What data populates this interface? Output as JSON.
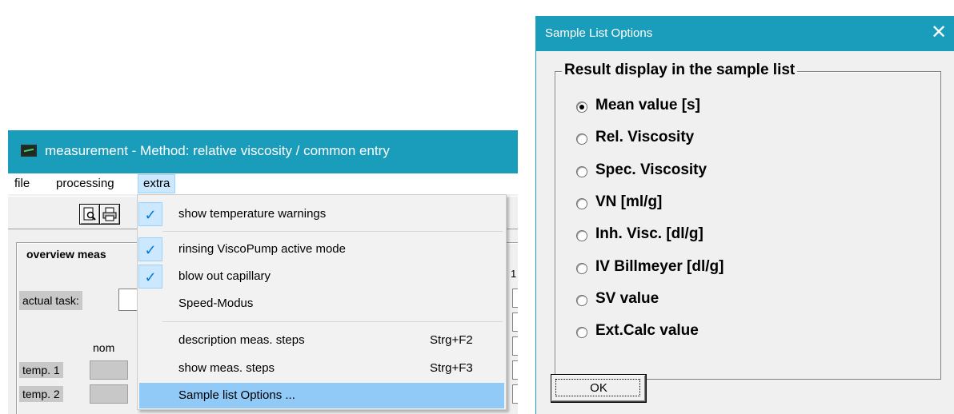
{
  "measurement_window": {
    "title": "measurement  -  Method: relative viscosity / common entry",
    "menu": [
      "file",
      "processing",
      "extra"
    ],
    "toolbar": {
      "preview_icon": "print-preview-icon",
      "print_icon": "printer-icon"
    },
    "overview_label": "overview meas",
    "actual_task_label": "actual task:",
    "nom_label": "nom",
    "temp1_label": "temp. 1",
    "temp2_label": "temp. 2",
    "column_label": "1"
  },
  "extra_menu": {
    "items": [
      {
        "label": "show temperature warnings",
        "checked": true,
        "shortcut": ""
      },
      {
        "label": "rinsing ViscoPump active mode",
        "checked": true,
        "shortcut": ""
      },
      {
        "label": "blow out capillary",
        "checked": true,
        "shortcut": ""
      },
      {
        "label": "Speed-Modus",
        "checked": false,
        "shortcut": ""
      },
      {
        "label": "description meas. steps",
        "checked": false,
        "shortcut": "Strg+F2"
      },
      {
        "label": "show meas. steps",
        "checked": false,
        "shortcut": "Strg+F3"
      },
      {
        "label": "Sample list Options ...",
        "checked": false,
        "shortcut": "",
        "highlighted": true
      }
    ],
    "check_glyph": "✓"
  },
  "dialog": {
    "title": "Sample List Options",
    "close_glyph": "✕",
    "group_label": "Result display in the sample list",
    "options": [
      {
        "label": "Mean value  [s]",
        "selected": true
      },
      {
        "label": "Rel. Viscosity",
        "selected": false
      },
      {
        "label": "Spec. Viscosity",
        "selected": false
      },
      {
        "label": "VN  [ml/g]",
        "selected": false
      },
      {
        "label": "Inh. Visc.  [dl/g]",
        "selected": false
      },
      {
        "label": "IV Billmeyer  [dl/g]",
        "selected": false
      },
      {
        "label": "SV value",
        "selected": false
      },
      {
        "label": "Ext.Calc value",
        "selected": false
      }
    ],
    "ok_label": "OK"
  },
  "colors": {
    "titlebar": "#1a9dbb",
    "menu_highlight": "#91c9f7",
    "check": "#0078d7"
  }
}
